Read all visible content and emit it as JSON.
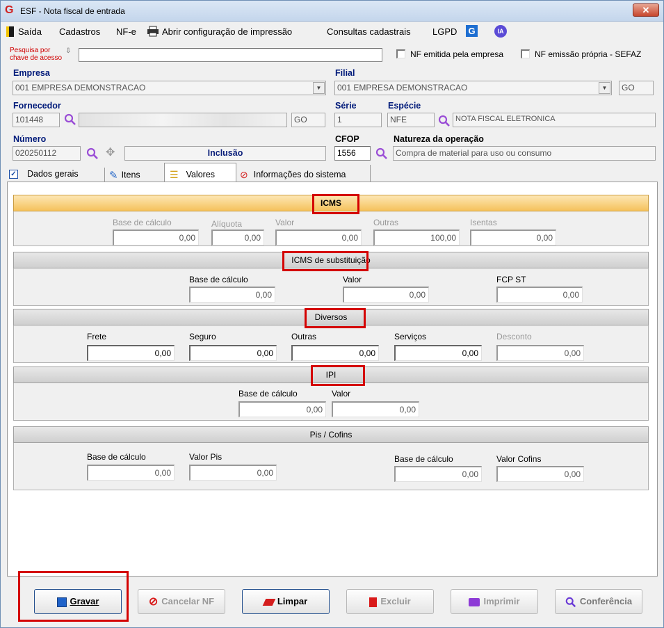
{
  "window": {
    "title": "ESF - Nota fiscal de entrada",
    "close": "✕"
  },
  "menu": {
    "saida": "Saída",
    "cadastros": "Cadastros",
    "nfe": "NF-e",
    "abrir_config": "Abrir configuração de impressão",
    "consultas": "Consultas cadastrais",
    "lgpd": "LGPD",
    "ia": "IA"
  },
  "search": {
    "label_line1": "Pesquisa por",
    "label_line2": "chave de acesso",
    "value": "",
    "nf_emitida": "NF emitida pela empresa",
    "nf_emissao": "NF emissão própria - SEFAZ"
  },
  "header": {
    "empresa_label": "Empresa",
    "empresa_value": "001 EMPRESA DEMONSTRACAO",
    "filial_label": "Filial",
    "filial_value": "001 EMPRESA DEMONSTRACAO",
    "filial_uf": "GO",
    "fornecedor_label": "Fornecedor",
    "fornecedor_code": "101448",
    "fornecedor_uf": "GO",
    "serie_label": "Série",
    "serie_value": "1",
    "especie_label": "Espécie",
    "especie_value": "NFE",
    "especie_desc": "NOTA FISCAL ELETRONICA",
    "numero_label": "Número",
    "numero_value": "020250112",
    "status": "Inclusão",
    "cfop_label": "CFOP",
    "cfop_value": "1556",
    "natureza_label": "Natureza da operação",
    "natureza_value": "Compra de material para uso ou consumo"
  },
  "tabs": [
    {
      "label": "Dados gerais"
    },
    {
      "label": "Itens"
    },
    {
      "label": "Valores"
    },
    {
      "label": "Informações do sistema"
    }
  ],
  "icms": {
    "title": "ICMS",
    "base_label": "Base de cálculo",
    "base": "0,00",
    "aliquota_label": "Alíquota",
    "aliquota": "0,00",
    "valor_label": "Valor",
    "valor": "0,00",
    "outras_label": "Outras",
    "outras": "100,00",
    "isentas_label": "Isentas",
    "isentas": "0,00"
  },
  "icms_st": {
    "title": "ICMS de substituição",
    "base_label": "Base de cálculo",
    "base": "0,00",
    "valor_label": "Valor",
    "valor": "0,00",
    "fcp_label": "FCP ST",
    "fcp": "0,00"
  },
  "diversos": {
    "title": "Diversos",
    "frete_label": "Frete",
    "frete": "0,00",
    "seguro_label": "Seguro",
    "seguro": "0,00",
    "outras_label": "Outras",
    "outras": "0,00",
    "servicos_label": "Serviços",
    "servicos": "0,00",
    "desconto_label": "Desconto",
    "desconto": "0,00"
  },
  "ipi": {
    "title": "IPI",
    "base_label": "Base de cálculo",
    "base": "0,00",
    "valor_label": "Valor",
    "valor": "0,00"
  },
  "pis_cofins": {
    "title": "Pis / Cofins",
    "pis_base_label": "Base de cálculo",
    "pis_base": "0,00",
    "pis_valor_label": "Valor Pis",
    "pis_valor": "0,00",
    "cofins_base_label": "Base de cálculo",
    "cofins_base": "0,00",
    "cofins_valor_label": "Valor Cofins",
    "cofins_valor": "0,00"
  },
  "buttons": {
    "gravar": "Gravar",
    "cancelar": "Cancelar NF",
    "limpar": "Limpar",
    "excluir": "Excluir",
    "imprimir": "Imprimir",
    "conferencia": "Conferência"
  },
  "colors": {
    "accent_red": "#d40000",
    "label_blue": "#001a7a",
    "icms_header": "#f5c25c"
  }
}
